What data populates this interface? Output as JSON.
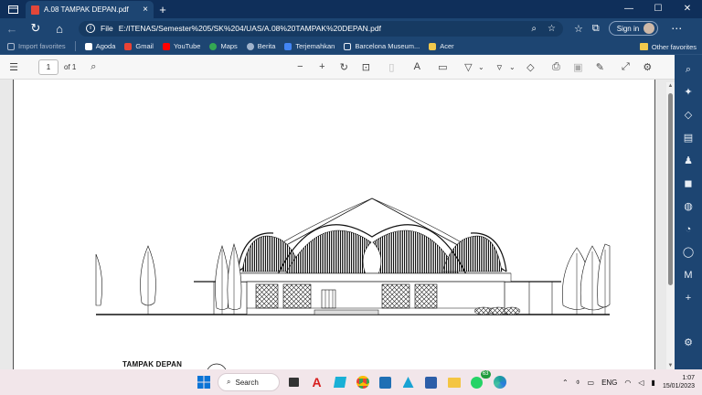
{
  "tab": {
    "title": "A.08 TAMPAK DEPAN.pdf",
    "close": "×",
    "new_tab": "+"
  },
  "window_controls": {
    "minimize": "—",
    "maximize": "☐",
    "close": "✕"
  },
  "address": {
    "scheme_label": "File",
    "url": "E:/ITENAS/Semester%205/SK%204/UAS/A.08%20TAMPAK%20DEPAN.pdf",
    "sign_in": "Sign in"
  },
  "favorites": [
    {
      "label": "Import favorites",
      "muted": true
    },
    {
      "label": "Agoda"
    },
    {
      "label": "Gmail"
    },
    {
      "label": "YouTube"
    },
    {
      "label": "Maps"
    },
    {
      "label": "Berita"
    },
    {
      "label": "Terjemahkan"
    },
    {
      "label": "Barcelona Museum..."
    },
    {
      "label": "Acer"
    }
  ],
  "other_favorites": "Other favorites",
  "pdf_toolbar": {
    "page_current": "1",
    "page_total_label": "of 1"
  },
  "document": {
    "drawing_label": "TAMPAK DEPAN"
  },
  "taskbar": {
    "search_label": "Search",
    "whatsapp_badge": "63",
    "language": "ENG",
    "time": "1:07",
    "date": "15/01/2023"
  },
  "colors": {
    "titlebar": "#0f2f5a",
    "chrome": "#1d4572",
    "taskbar": "#f2e6ea"
  }
}
